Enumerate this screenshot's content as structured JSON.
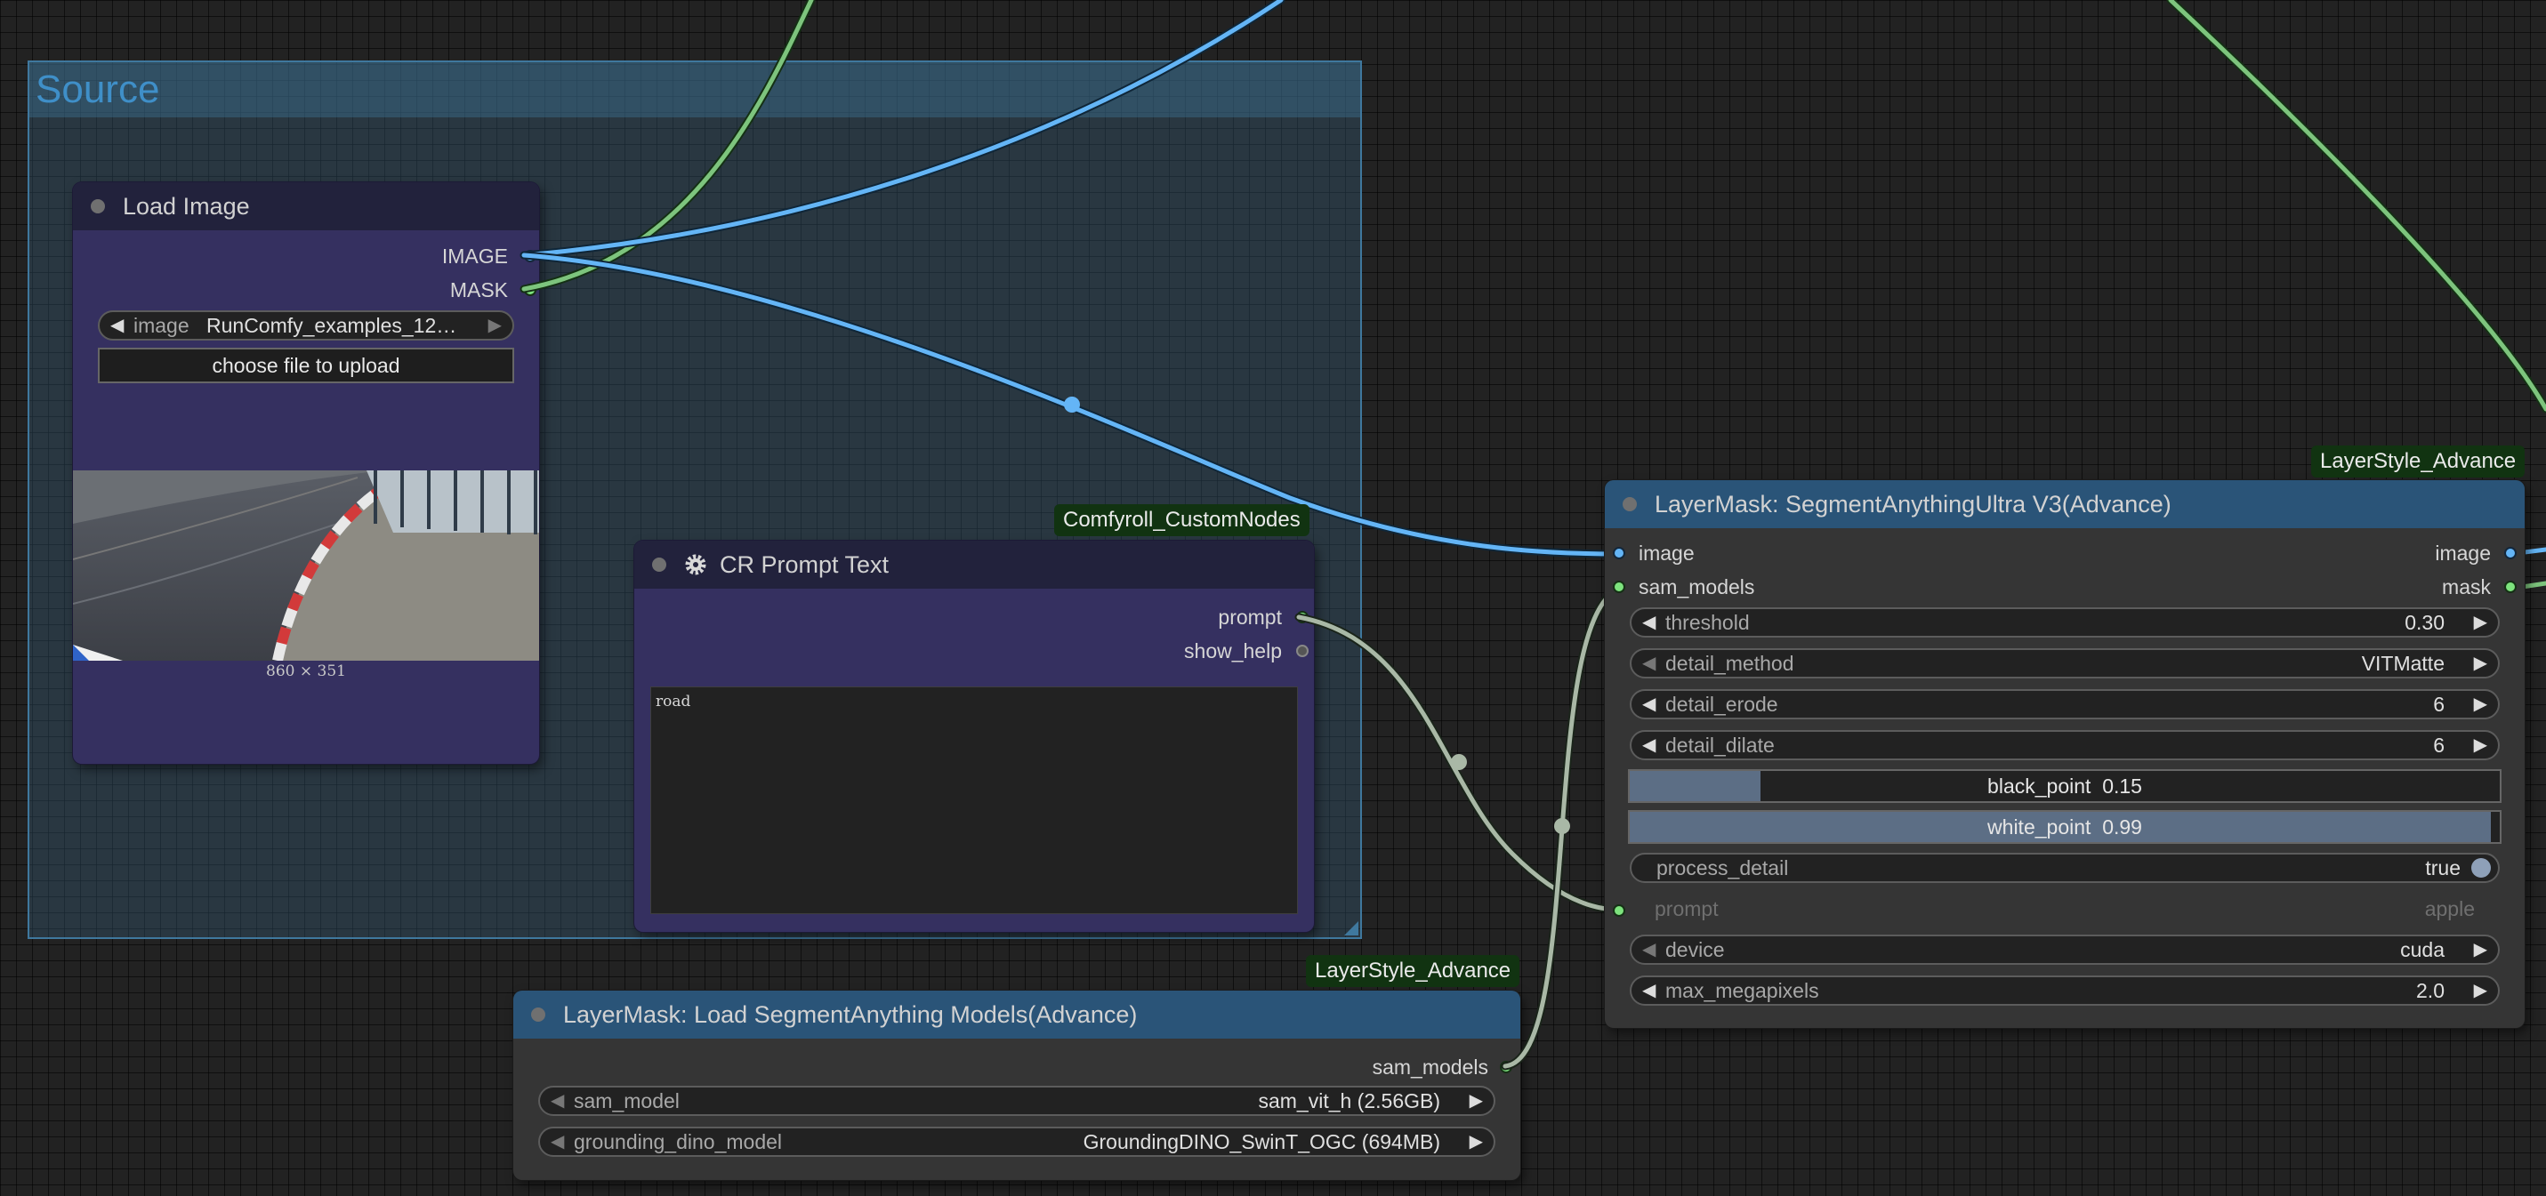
{
  "group": {
    "title": "Source"
  },
  "load_image": {
    "title": "Load Image",
    "outputs": {
      "image": "IMAGE",
      "mask": "MASK"
    },
    "image_widget": {
      "label": "image",
      "value": "RunComfy_examples_12…"
    },
    "upload_button": "choose file to upload",
    "dimensions": "860 × 351"
  },
  "cr_prompt": {
    "badge": "Comfyroll_CustomNodes",
    "title": "CR Prompt Text",
    "outputs": {
      "prompt": "prompt",
      "show_help": "show_help"
    },
    "text": "road"
  },
  "sam_loader": {
    "badge": "LayerStyle_Advance",
    "title": "LayerMask: Load SegmentAnything Models(Advance)",
    "output": "sam_models",
    "widgets": [
      {
        "label": "sam_model",
        "value": "sam_vit_h (2.56GB)"
      },
      {
        "label": "grounding_dino_model",
        "value": "GroundingDINO_SwinT_OGC (694MB)"
      }
    ]
  },
  "sam_ultra": {
    "badge": "LayerStyle_Advance",
    "title": "LayerMask: SegmentAnythingUltra V3(Advance)",
    "inputs": {
      "image": "image",
      "sam_models": "sam_models",
      "prompt": "prompt"
    },
    "outputs": {
      "image": "image",
      "mask": "mask"
    },
    "widgets": {
      "threshold": {
        "label": "threshold",
        "value": "0.30"
      },
      "detail_method": {
        "label": "detail_method",
        "value": "VITMatte"
      },
      "detail_erode": {
        "label": "detail_erode",
        "value": "6"
      },
      "detail_dilate": {
        "label": "detail_dilate",
        "value": "6"
      },
      "black_point": {
        "label": "black_point",
        "value": "0.15",
        "fraction": 0.15
      },
      "white_point": {
        "label": "white_point",
        "value": "0.99",
        "fraction": 0.99
      },
      "process_detail": {
        "label": "process_detail",
        "value": "true"
      },
      "prompt_value": "apple",
      "device": {
        "label": "device",
        "value": "cuda"
      },
      "max_megapixels": {
        "label": "max_megapixels",
        "value": "2.0"
      }
    }
  },
  "colors": {
    "image_wire": "#64b5f6",
    "mask_wire": "#7de37d",
    "generic_wire": "#a9b8a6",
    "group": "#3f789e",
    "badge_bg": "#113311"
  }
}
